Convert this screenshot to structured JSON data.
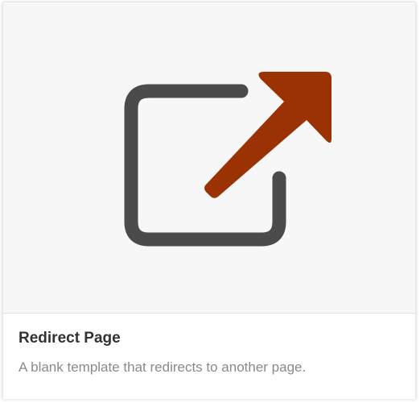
{
  "card": {
    "title": "Redirect Page",
    "description": "A blank template that redirects to another page.",
    "icon": "external-link-icon"
  },
  "colors": {
    "frame": "#4b4b4b",
    "arrow": "#9a3203",
    "thumbnail_background": "#f7f7f7",
    "title_text": "#323232",
    "description_text": "#8a8a8a"
  }
}
